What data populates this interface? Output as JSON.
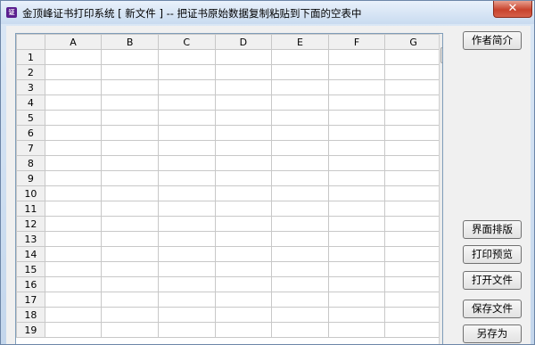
{
  "window": {
    "icon_text": "证",
    "title": "金顶峰证书打印系统 [ 新文件 ] -- 把证书原始数据复制粘贴到下面的空表中",
    "close_glyph": "✕"
  },
  "grid": {
    "columns": [
      "A",
      "B",
      "C",
      "D",
      "E",
      "F",
      "G"
    ],
    "rows": [
      "1",
      "2",
      "3",
      "4",
      "5",
      "6",
      "7",
      "8",
      "9",
      "10",
      "11",
      "12",
      "13",
      "14",
      "15",
      "16",
      "17",
      "18",
      "19"
    ]
  },
  "buttons": {
    "author_intro": "作者简介",
    "layout": "界面排版",
    "print_preview": "打印预览",
    "open_file": "打开文件",
    "save_file": "保存文件",
    "save_as": "另存为"
  },
  "colors": {
    "title_bg": "#dbe8f6",
    "close_bg": "#c8432d",
    "grid_line": "#c8c8c8"
  }
}
